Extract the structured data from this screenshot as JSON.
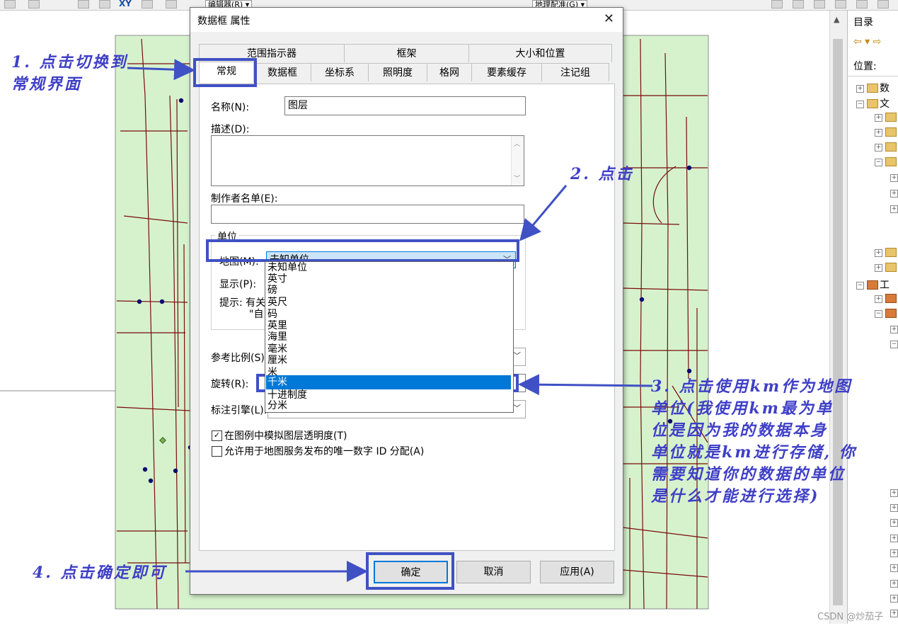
{
  "toolbar": {
    "editor_menu": "编辑器(R) ▾",
    "georef_menu": "地理配准(G) ▾",
    "xy_label": "XY"
  },
  "catalog": {
    "title": "目录",
    "location_label": "位置:",
    "tree_items": [
      "数",
      "文",
      "工"
    ]
  },
  "watermark": "CSDN @炒茄子",
  "dialog": {
    "title": "数据框 属性",
    "tabs_top": [
      "范围指示器",
      "框架",
      "大小和位置"
    ],
    "tabs_bottom": [
      "常规",
      "数据框",
      "坐标系",
      "照明度",
      "格网",
      "要素缓存",
      "注记组"
    ],
    "general": {
      "name_label": "名称(N):",
      "name_value": "图层",
      "description_label": "描述(D):",
      "credits_label": "制作者名单(E):",
      "units_group": "单位",
      "map_units_label": "地图(M):",
      "map_units_value": "未知单位",
      "display_units_label": "显示(P):",
      "hint_label": "提示: 有关",
      "hint_line2": "\"自",
      "ref_scale_label": "参考比例(S)",
      "rotation_label": "旋转(R):",
      "label_engine_label": "标注引擎(L):",
      "check1_label": "在图例中模拟图层透明度(T)",
      "check1_checked": true,
      "check2_label": "允许用于地图服务发布的唯一数字 ID 分配(A)",
      "check2_checked": false
    },
    "unit_options": [
      "未知单位",
      "英寸",
      "磅",
      "英尺",
      "码",
      "英里",
      "海里",
      "毫米",
      "厘米",
      "米",
      "千米",
      "十进制度",
      "分米"
    ],
    "selected_option_index": 10,
    "buttons": {
      "ok": "确定",
      "cancel": "取消",
      "apply": "应用(A)"
    }
  },
  "annotations": {
    "step1_line1": "1. 点击切换到",
    "step1_line2": "常规界面",
    "step2": "2. 点击",
    "step3_lines": [
      "3. 点击使用km作为地图",
      "单位(我使用km最为单",
      "位是因为我的数据本身",
      "单位就是km进行存储, 你",
      "需要知道你的数据的单位",
      "是什么才能进行选择)"
    ],
    "step4": "4. 点击确定即可",
    "color": "#3f51c4"
  },
  "map_colors": {
    "land": "#d6f2cd",
    "roads": "#7a0c0c",
    "points": "#0a0a6e",
    "boundary": "#8c8c8c"
  }
}
